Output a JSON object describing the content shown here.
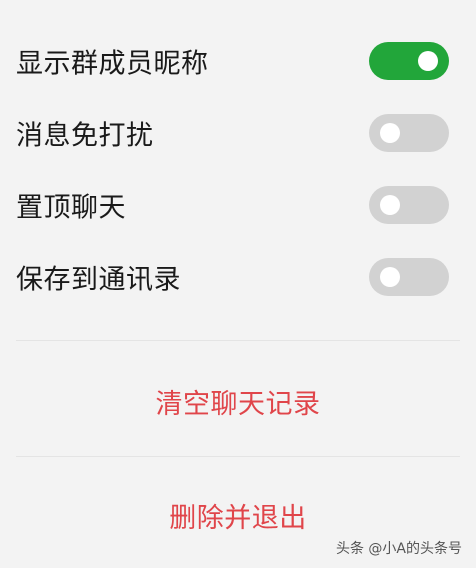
{
  "settings": [
    {
      "label": "显示群成员昵称",
      "enabled": true
    },
    {
      "label": "消息免打扰",
      "enabled": false
    },
    {
      "label": "置顶聊天",
      "enabled": false
    },
    {
      "label": "保存到通讯录",
      "enabled": false
    }
  ],
  "actions": {
    "clear_history": "清空聊天记录",
    "delete_and_exit": "删除并退出"
  },
  "watermark": "头条 @小A的头条号",
  "colors": {
    "toggle_on": "#22a63a",
    "toggle_off": "#d2d2d2",
    "action_text": "#e0454a",
    "background": "#f3f3f3"
  }
}
